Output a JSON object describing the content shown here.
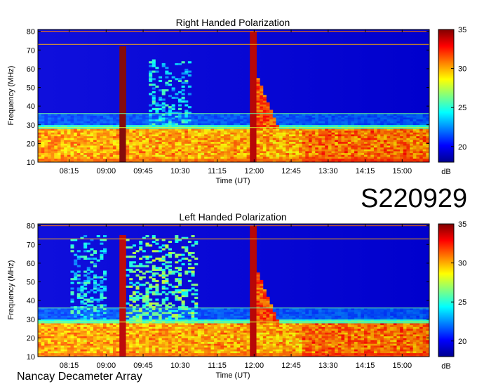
{
  "figure_id": "S220929",
  "footer_text": "Nancay Decameter Array",
  "colorbar": {
    "ticks": [
      "35",
      "30",
      "25",
      "20"
    ],
    "tick_values": [
      35,
      30,
      25,
      20
    ],
    "range": [
      18,
      35
    ],
    "unit_label": "dB",
    "colors": [
      "#00008f",
      "#0000ff",
      "#0080ff",
      "#00ffff",
      "#80ff80",
      "#ffff00",
      "#ff8000",
      "#ff0000",
      "#800000"
    ]
  },
  "chart_data": [
    {
      "type": "heatmap",
      "title": "Right Handed Polarization",
      "xlabel": "Time (UT)",
      "ylabel": "Frequency (MHz)",
      "xticks": [
        "08:15",
        "09:00",
        "09:45",
        "10:30",
        "11:15",
        "12:00",
        "12:45",
        "13:30",
        "14:15",
        "15:00"
      ],
      "xlim": [
        "07:37",
        "15:33"
      ],
      "ylim": [
        10,
        81
      ],
      "yticks": [
        10,
        20,
        30,
        40,
        50,
        60,
        70,
        80
      ],
      "value_unit": "dB",
      "zlim": [
        18,
        35
      ],
      "features": [
        {
          "label": "type III burst",
          "time": "09:20",
          "freq_range": [
            10,
            72
          ],
          "intensity_db": 35
        },
        {
          "label": "broadband emission",
          "time_range": [
            "09:50",
            "10:45"
          ],
          "freq_range": [
            25,
            65
          ],
          "intensity_db": 26
        },
        {
          "label": "type III burst",
          "time": "11:59",
          "freq_range": [
            10,
            80
          ],
          "intensity_db": 34
        },
        {
          "label": "drifting emission",
          "time_range": [
            "12:00",
            "12:30"
          ],
          "freq_range": [
            28,
            60
          ],
          "intensity_db": 33
        },
        {
          "label": "low-frequency band",
          "time_range": [
            "07:37",
            "15:33"
          ],
          "freq_range": [
            10,
            28
          ],
          "intensity_db": 30
        }
      ]
    },
    {
      "type": "heatmap",
      "title": "Left Handed Polarization",
      "xlabel": "Time (UT)",
      "ylabel": "Frequency (MHz)",
      "xticks": [
        "08:15",
        "09:00",
        "09:45",
        "10:30",
        "11:15",
        "12:00",
        "12:45",
        "13:30",
        "14:15",
        "15:00"
      ],
      "xlim": [
        "07:37",
        "15:33"
      ],
      "ylim": [
        10,
        81
      ],
      "yticks": [
        10,
        20,
        30,
        40,
        50,
        60,
        70,
        80
      ],
      "value_unit": "dB",
      "zlim": [
        18,
        35
      ],
      "features": [
        {
          "label": "broadband emission",
          "time_range": [
            "08:15",
            "09:00"
          ],
          "freq_range": [
            20,
            75
          ],
          "intensity_db": 26
        },
        {
          "label": "type III burst",
          "time": "09:20",
          "freq_range": [
            10,
            75
          ],
          "intensity_db": 34
        },
        {
          "label": "broadband emission",
          "time_range": [
            "09:20",
            "10:50"
          ],
          "freq_range": [
            22,
            75
          ],
          "intensity_db": 28
        },
        {
          "label": "type III burst",
          "time": "11:59",
          "freq_range": [
            10,
            80
          ],
          "intensity_db": 34
        },
        {
          "label": "drifting emission",
          "time_range": [
            "12:00",
            "12:30"
          ],
          "freq_range": [
            28,
            60
          ],
          "intensity_db": 33
        },
        {
          "label": "low-frequency band",
          "time_range": [
            "07:37",
            "15:33"
          ],
          "freq_range": [
            10,
            28
          ],
          "intensity_db": 30
        }
      ]
    }
  ]
}
